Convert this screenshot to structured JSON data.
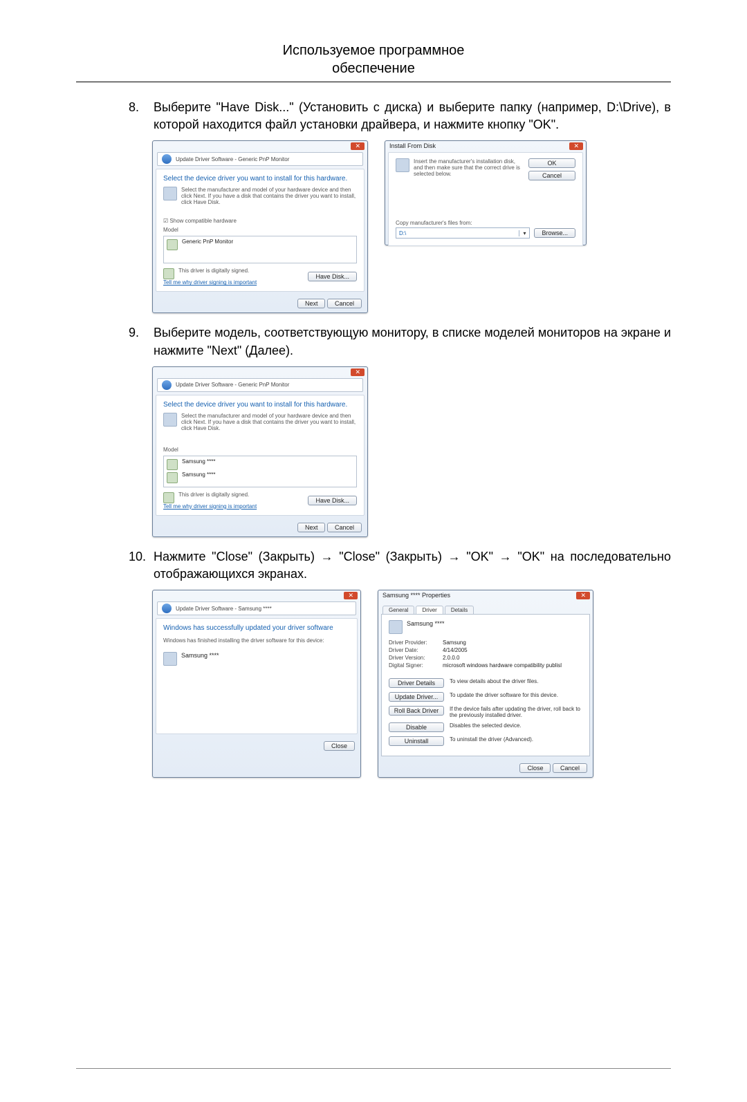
{
  "header": {
    "line1": "Используемое программное",
    "line2": "обеспечение"
  },
  "steps": {
    "s8": {
      "num": "8.",
      "text": "Выберите \"Have Disk...\" (Установить с диска) и выберите папку (например, D:\\Drive), в которой находится файл установки драйвера, и нажмите кнопку \"OK\"."
    },
    "s9": {
      "num": "9.",
      "text": "Выберите модель, соответствующую монитору, в списке моделей мониторов на экране и нажмите \"Next\" (Далее)."
    },
    "s10": {
      "num": "10.",
      "text": "Нажмите \"Close\" (Закрыть) → \"Close\" (Закрыть) → \"OK\" → \"OK\" на последовательно отображающихся экранах."
    }
  },
  "dlg8a": {
    "crumb": "Update Driver Software - Generic PnP Monitor",
    "title": "Select the device driver you want to install for this hardware.",
    "desc": "Select the manufacturer and model of your hardware device and then click Next. If you have a disk that contains the driver you want to install, click Have Disk.",
    "check": "Show compatible hardware",
    "modelHdr": "Model",
    "model1": "Generic PnP Monitor",
    "signed": "This driver is digitally signed.",
    "link": "Tell me why driver signing is important",
    "haveDisk": "Have Disk...",
    "next": "Next",
    "cancel": "Cancel"
  },
  "dlg8b": {
    "title": "Install From Disk",
    "desc": "Insert the manufacturer's installation disk, and then make sure that the correct drive is selected below.",
    "ok": "OK",
    "cancel": "Cancel",
    "copy": "Copy manufacturer's files from:",
    "path": "D:\\",
    "browse": "Browse..."
  },
  "dlg9": {
    "crumb": "Update Driver Software - Generic PnP Monitor",
    "title": "Select the device driver you want to install for this hardware.",
    "desc": "Select the manufacturer and model of your hardware device and then click Next. If you have a disk that contains the driver you want to install, click Have Disk.",
    "modelHdr": "Model",
    "m1": "Samsung ****",
    "m2": "Samsung ****",
    "signed": "This driver is digitally signed.",
    "link": "Tell me why driver signing is important",
    "haveDisk": "Have Disk...",
    "next": "Next",
    "cancel": "Cancel"
  },
  "dlg10a": {
    "crumb": "Update Driver Software - Samsung ****",
    "title": "Windows has successfully updated your driver software",
    "desc": "Windows has finished installing the driver software for this device:",
    "device": "Samsung ****",
    "close": "Close"
  },
  "dlg10b": {
    "title": "Samsung **** Properties",
    "tabs": {
      "general": "General",
      "driver": "Driver",
      "details": "Details"
    },
    "device": "Samsung ****",
    "provK": "Driver Provider:",
    "provV": "Samsung",
    "dateK": "Driver Date:",
    "dateV": "4/14/2005",
    "verK": "Driver Version:",
    "verV": "2.0.0.0",
    "sigK": "Digital Signer:",
    "sigV": "microsoft windows hardware compatibility publisl",
    "bDetails": "Driver Details",
    "dDetails": "To view details about the driver files.",
    "bUpdate": "Update Driver...",
    "dUpdate": "To update the driver software for this device.",
    "bRoll": "Roll Back Driver",
    "dRoll": "If the device fails after updating the driver, roll back to the previously installed driver.",
    "bDisable": "Disable",
    "dDisable": "Disables the selected device.",
    "bUninstall": "Uninstall",
    "dUninstall": "To uninstall the driver (Advanced).",
    "close": "Close",
    "cancel": "Cancel"
  }
}
